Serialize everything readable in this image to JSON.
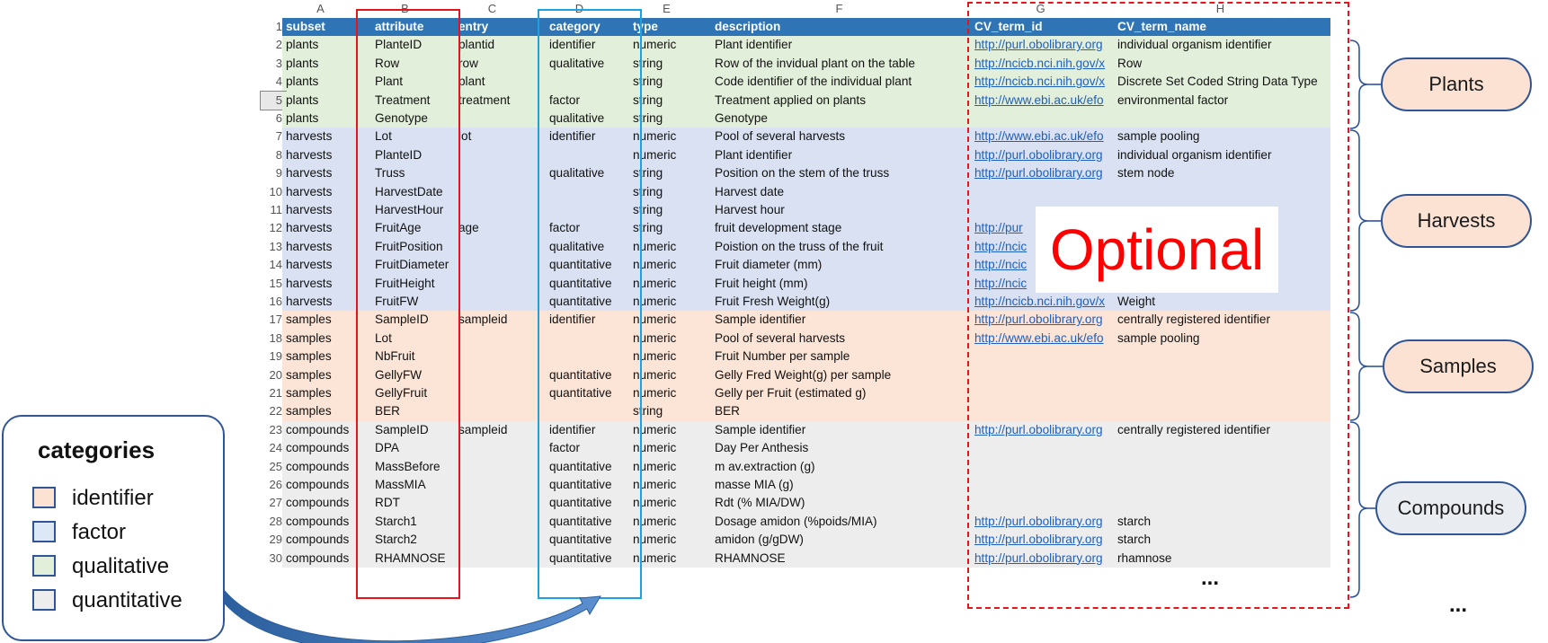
{
  "sheet": {
    "column_letters": [
      "A",
      "B",
      "C",
      "D",
      "E",
      "F",
      "G",
      "H"
    ],
    "header": [
      "subset",
      "attribute",
      "entry",
      "category",
      "type",
      "description",
      "CV_term_id",
      "CV_term_name"
    ],
    "rows": [
      {
        "n": "2",
        "group": "plants",
        "cells": [
          "plants",
          "PlanteID",
          "plantid",
          "identifier",
          "numeric",
          "Plant identifier",
          "http://purl.obolibrary.org",
          "individual organism identifier"
        ]
      },
      {
        "n": "3",
        "group": "plants",
        "cells": [
          "plants",
          "Row",
          "row",
          "qualitative",
          "string",
          "Row of the invidual plant on the table",
          "http://ncicb.nci.nih.gov/x",
          "Row"
        ]
      },
      {
        "n": "4",
        "group": "plants",
        "cells": [
          "plants",
          "Plant",
          "plant",
          "",
          "string",
          "Code identifier of the individual plant",
          "http://ncicb.nci.nih.gov/x",
          "Discrete Set Coded String Data Type"
        ]
      },
      {
        "n": "5",
        "group": "plants",
        "cells": [
          "plants",
          "Treatment",
          "treatment",
          "factor",
          "string",
          "Treatment applied on plants",
          "http://www.ebi.ac.uk/efo",
          "environmental factor"
        ]
      },
      {
        "n": "6",
        "group": "plants",
        "cells": [
          "plants",
          "Genotype",
          "",
          "qualitative",
          "string",
          "Genotype",
          "",
          ""
        ]
      },
      {
        "n": "7",
        "group": "harvests",
        "cells": [
          "harvests",
          "Lot",
          "lot",
          "identifier",
          "numeric",
          "Pool of several harvests",
          "http://www.ebi.ac.uk/efo",
          "sample pooling"
        ]
      },
      {
        "n": "8",
        "group": "harvests",
        "cells": [
          "harvests",
          "PlanteID",
          "",
          "",
          "numeric",
          "Plant identifier",
          "http://purl.obolibrary.org",
          "individual organism identifier"
        ]
      },
      {
        "n": "9",
        "group": "harvests",
        "cells": [
          "harvests",
          "Truss",
          "",
          "qualitative",
          "string",
          "Position on the stem of the truss",
          "http://purl.obolibrary.org",
          "stem node"
        ]
      },
      {
        "n": "10",
        "group": "harvests",
        "cells": [
          "harvests",
          "HarvestDate",
          "",
          "",
          "string",
          "Harvest date",
          "",
          ""
        ]
      },
      {
        "n": "11",
        "group": "harvests",
        "cells": [
          "harvests",
          "HarvestHour",
          "",
          "",
          "string",
          "Harvest hour",
          "",
          ""
        ]
      },
      {
        "n": "12",
        "group": "harvests",
        "cells": [
          "harvests",
          "FruitAge",
          "age",
          "factor",
          "string",
          "fruit development stage",
          "http://pur",
          ""
        ]
      },
      {
        "n": "13",
        "group": "harvests",
        "cells": [
          "harvests",
          "FruitPosition",
          "",
          "qualitative",
          "numeric",
          "Poistion on the truss of the fruit",
          "http://ncic",
          ""
        ]
      },
      {
        "n": "14",
        "group": "harvests",
        "cells": [
          "harvests",
          "FruitDiameter",
          "",
          "quantitative",
          "numeric",
          "Fruit diameter (mm)",
          "http://ncic",
          ""
        ]
      },
      {
        "n": "15",
        "group": "harvests",
        "cells": [
          "harvests",
          "FruitHeight",
          "",
          "quantitative",
          "numeric",
          "Fruit height (mm)",
          "http://ncic",
          ""
        ]
      },
      {
        "n": "16",
        "group": "harvests",
        "cells": [
          "harvests",
          "FruitFW",
          "",
          "quantitative",
          "numeric",
          "Fruit Fresh Weight(g)",
          "http://ncicb.nci.nih.gov/x",
          "Weight"
        ]
      },
      {
        "n": "17",
        "group": "samples",
        "cells": [
          "samples",
          "SampleID",
          "sampleid",
          "identifier",
          "numeric",
          "Sample identifier",
          "http://purl.obolibrary.org",
          "centrally registered identifier"
        ]
      },
      {
        "n": "18",
        "group": "samples",
        "cells": [
          "samples",
          "Lot",
          "",
          "",
          "numeric",
          "Pool of several harvests",
          "http://www.ebi.ac.uk/efo",
          "sample pooling"
        ]
      },
      {
        "n": "19",
        "group": "samples",
        "cells": [
          "samples",
          "NbFruit",
          "",
          "",
          "numeric",
          "Fruit Number per sample",
          "",
          ""
        ]
      },
      {
        "n": "20",
        "group": "samples",
        "cells": [
          "samples",
          "GellyFW",
          "",
          "quantitative",
          "numeric",
          "Gelly Fred Weight(g) per sample",
          "",
          ""
        ]
      },
      {
        "n": "21",
        "group": "samples",
        "cells": [
          "samples",
          "GellyFruit",
          "",
          "quantitative",
          "numeric",
          "Gelly per Fruit (estimated g)",
          "",
          ""
        ]
      },
      {
        "n": "22",
        "group": "samples",
        "cells": [
          "samples",
          "BER",
          "",
          "",
          "string",
          "BER",
          "",
          ""
        ]
      },
      {
        "n": "23",
        "group": "compounds",
        "cells": [
          "compounds",
          "SampleID",
          "sampleid",
          "identifier",
          "numeric",
          "Sample identifier",
          "http://purl.obolibrary.org",
          "centrally registered identifier"
        ]
      },
      {
        "n": "24",
        "group": "compounds",
        "cells": [
          "compounds",
          "DPA",
          "",
          "factor",
          "numeric",
          "Day Per Anthesis",
          "",
          ""
        ]
      },
      {
        "n": "25",
        "group": "compounds",
        "cells": [
          "compounds",
          "MassBefore",
          "",
          "quantitative",
          "numeric",
          "m av.extraction  (g)",
          "",
          ""
        ]
      },
      {
        "n": "26",
        "group": "compounds",
        "cells": [
          "compounds",
          "MassMIA",
          "",
          "quantitative",
          "numeric",
          "masse MIA (g)",
          "",
          ""
        ]
      },
      {
        "n": "27",
        "group": "compounds",
        "cells": [
          "compounds",
          "RDT",
          "",
          "quantitative",
          "numeric",
          "Rdt (% MIA/DW)",
          "",
          ""
        ]
      },
      {
        "n": "28",
        "group": "compounds",
        "cells": [
          "compounds",
          "Starch1",
          "",
          "quantitative",
          "numeric",
          "Dosage amidon (%poids/MIA)",
          "http://purl.obolibrary.org",
          "starch"
        ]
      },
      {
        "n": "29",
        "group": "compounds",
        "cells": [
          "compounds",
          "Starch2",
          "",
          "quantitative",
          "numeric",
          "amidon (g/gDW)",
          "http://purl.obolibrary.org",
          "starch"
        ]
      },
      {
        "n": "30",
        "group": "compounds",
        "cells": [
          "compounds",
          "RHAMNOSE",
          "",
          "quantitative",
          "numeric",
          "RHAMNOSE",
          "http://purl.obolibrary.org",
          "rhamnose"
        ]
      }
    ],
    "header_row_number": "1",
    "ellipsis": "..."
  },
  "optional_label": "Optional",
  "groups": {
    "plants": "Plants",
    "harvests": "Harvests",
    "samples": "Samples",
    "compounds": "Compounds",
    "ellipsis": "..."
  },
  "legend": {
    "title": "categories",
    "items": [
      {
        "label": "identifier",
        "color": "#fbe2d3"
      },
      {
        "label": "factor",
        "color": "#dde8f6"
      },
      {
        "label": "qualitative",
        "color": "#e2efda"
      },
      {
        "label": "quantitative",
        "color": "#ededed"
      }
    ]
  },
  "colors": {
    "header_blue": "#2f75b6",
    "plants": "#e2efda",
    "harvests": "#d9e1f2",
    "samples": "#fce4d6",
    "compounds": "#ededed",
    "attribute_frame": "#e8141b",
    "category_frame": "#1aa3e0",
    "optional_frame": "#e8141b",
    "group_outline": "#2f5597"
  }
}
